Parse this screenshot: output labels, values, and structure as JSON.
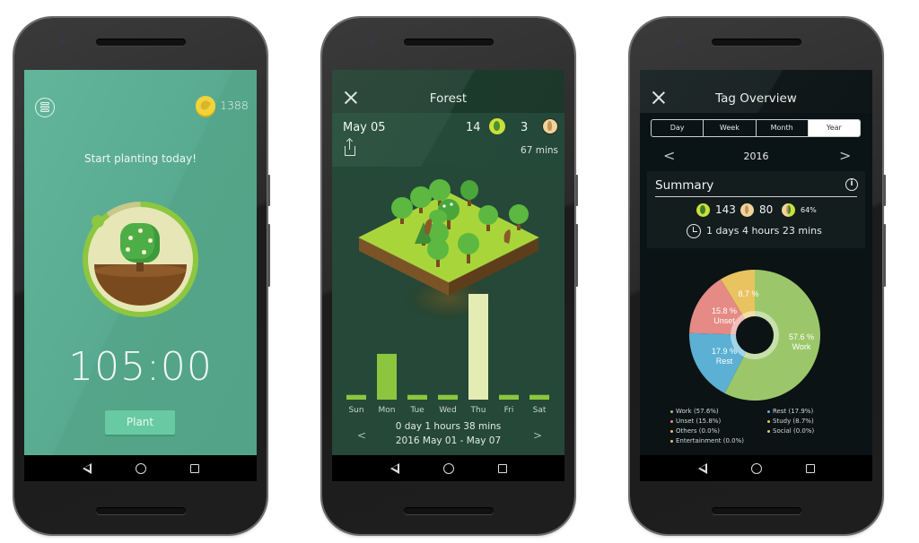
{
  "phones": {
    "home": {
      "coins": "1388",
      "prompt": "Start planting today!",
      "timer": "105:00",
      "plant_button": "Plant",
      "timer_progress": 0.9,
      "colors": {
        "background": "#55a78b",
        "ring": "#8dc63f",
        "button": "#67caa3"
      }
    },
    "forest": {
      "title": "Forest",
      "date": "May 05",
      "healthy_count": "14",
      "withered_count": "3",
      "duration": "67 mins",
      "chart_days": [
        "Sun",
        "Mon",
        "Tue",
        "Wed",
        "Thu",
        "Fri",
        "Sat"
      ],
      "total_time": "0 day 1 hours 38 mins",
      "range": "2016 May 01 - May 07",
      "prev": "<",
      "next": ">"
    },
    "tag_overview": {
      "title": "Tag Overview",
      "segments": [
        "Day",
        "Week",
        "Month",
        "Year"
      ],
      "active_segment": "Year",
      "year": "2016",
      "prev": "<",
      "next": ">",
      "summary": {
        "title": "Summary",
        "healthy": "143",
        "withered": "80",
        "success_rate": "64%",
        "total_time": "1 days 4 hours 23 mins"
      },
      "slice_labels": {
        "work_pct": "57.6 %",
        "work": "Work",
        "rest_pct": "17.9 %",
        "rest": "Rest",
        "unset_pct": "15.8 %",
        "unset": "Unset",
        "study_pct": "8.7 %"
      },
      "legend": [
        {
          "label": "Work (57.6%)",
          "color": "#9bc76a"
        },
        {
          "label": "Rest (17.9%)",
          "color": "#5bb0d4"
        },
        {
          "label": "Unset (15.8%)",
          "color": "#e58a85"
        },
        {
          "label": "Study (8.7%)",
          "color": "#e8c35f"
        },
        {
          "label": "Others (0.0%)",
          "color": "#e8c35f"
        },
        {
          "label": "Social (0.0%)",
          "color": "#e8c35f"
        },
        {
          "label": "Entertainment (0.0%)",
          "color": "#e8c35f"
        }
      ]
    }
  },
  "chart_data": [
    {
      "type": "bar",
      "title": "",
      "categories": [
        "Sun",
        "Mon",
        "Tue",
        "Wed",
        "Thu",
        "Fri",
        "Sat"
      ],
      "values": [
        3,
        29,
        3,
        3,
        67,
        3,
        3
      ],
      "xlabel": "",
      "ylabel": "mins",
      "highlight": "Thu",
      "ylim": [
        0,
        67
      ]
    },
    {
      "type": "pie",
      "title": "",
      "categories": [
        "Work",
        "Rest",
        "Unset",
        "Study"
      ],
      "values": [
        57.6,
        17.9,
        15.8,
        8.7
      ],
      "colors": [
        "#9bc76a",
        "#5bb0d4",
        "#e58a85",
        "#e8c35f"
      ],
      "legend_position": "bottom"
    }
  ]
}
